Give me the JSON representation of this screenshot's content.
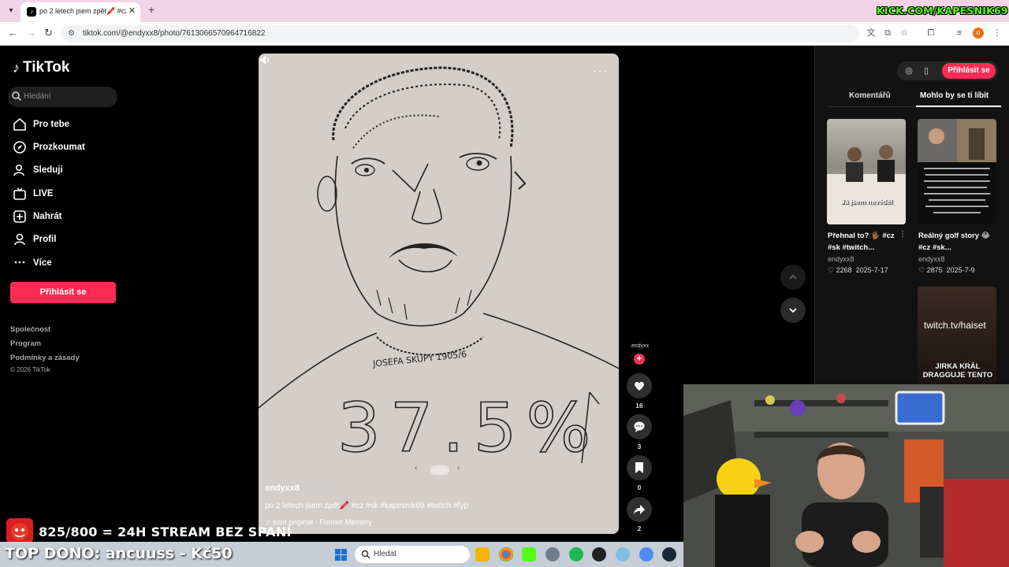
{
  "browser": {
    "tab_title": "po 2 letech jsem zpět🖍️ #cz #s",
    "url": "tiktok.com/@endyxx8/photo/7613066570964716822",
    "overlay_brand": "KICK.COM/KAPESNIK69"
  },
  "tiktok": {
    "logo": "TikTok",
    "search_placeholder": "Hledání",
    "nav": [
      {
        "label": "Pro tebe",
        "icon": "home-icon"
      },
      {
        "label": "Prozkoumat",
        "icon": "compass-icon"
      },
      {
        "label": "Sleduji",
        "icon": "person-icon"
      },
      {
        "label": "LIVE",
        "icon": "live-tv-icon"
      },
      {
        "label": "Nahrát",
        "icon": "upload-plus-icon"
      },
      {
        "label": "Profil",
        "icon": "profile-icon"
      },
      {
        "label": "Více",
        "icon": "more-dots-icon"
      }
    ],
    "login_button": "Přihlásit se",
    "footer": {
      "company": "Společnost",
      "program": "Program",
      "terms": "Podmínky a zásady",
      "copyright": "© 2026 TikTok"
    },
    "post": {
      "author": "endyxx8",
      "ago": "· Před 3 d",
      "caption": "po 2 letech jsem zpět🖍️ #cz #sk #kapesnik69 #twitch #fyp",
      "music": "♫  som original - Formal Memory",
      "drawing_text": "37.5%",
      "necklace_text": "JOSEFA SKUPY 1905/6"
    },
    "actions": {
      "avatar_name": "endyxx",
      "likes": "16",
      "comments": "3",
      "saves": "0",
      "shares": "2"
    },
    "right_panel": {
      "login": "Přihlásit se",
      "tab_comments": "Komentářů",
      "tab_suggested": "Mohlo by se ti líbit",
      "cards": [
        {
          "overlay": "Já jsem nevěděl",
          "title": "Přehnal to? 🖐🏾 #cz #sk #twitch...",
          "user": "endyxx8",
          "likes": "♡ 2268",
          "date": "2025-7-17"
        },
        {
          "title": "Reálný golf story 😂 #cz #sk...",
          "user": "endyxx8",
          "likes": "♡ 2875",
          "date": "2025-7-9"
        },
        {
          "overlay_link": "twitch.tv/haiset",
          "overlay_text": "JIRKA KRÁL DRAGGUJE TENTO"
        }
      ]
    }
  },
  "stream_overlay": {
    "goal": "825/800 = 24H STREAM BEZ SPANÍ",
    "top_dono": "TOP DONO: ancuuss - Kč50"
  },
  "taskbar": {
    "search_placeholder": "Hledat"
  },
  "colors": {
    "accent": "#fe2c55",
    "kick_green": "#53fc18",
    "tab_strip": "#f3d4e6"
  }
}
